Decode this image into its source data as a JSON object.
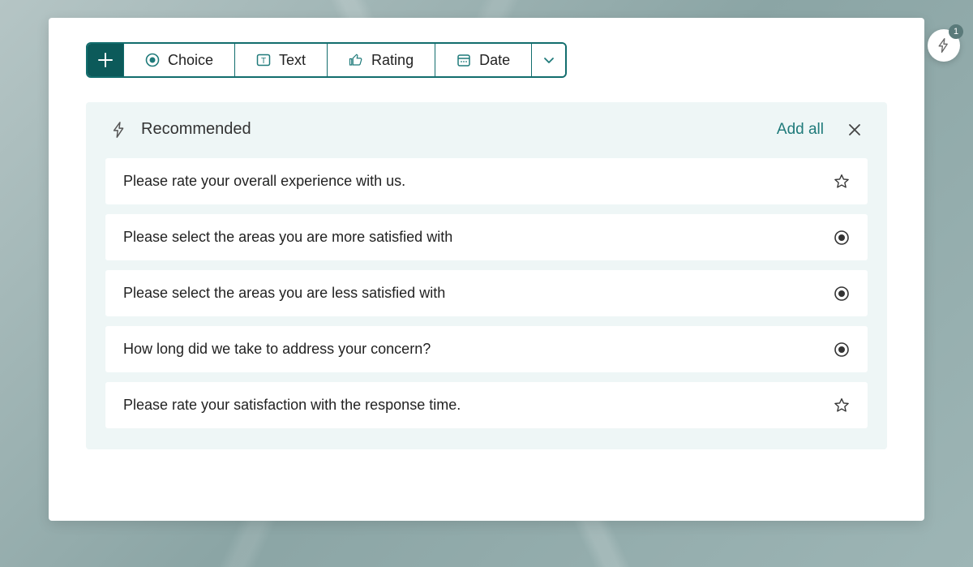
{
  "toolbar": {
    "choice_label": "Choice",
    "text_label": "Text",
    "rating_label": "Rating",
    "date_label": "Date"
  },
  "recommended": {
    "title": "Recommended",
    "add_all_label": "Add all",
    "items": [
      {
        "text": "Please rate your overall experience with us.",
        "type": "rating"
      },
      {
        "text": "Please select the areas you are more satisfied with",
        "type": "choice"
      },
      {
        "text": "Please select the areas you are less satisfied with",
        "type": "choice"
      },
      {
        "text": "How long did we take to address your concern?",
        "type": "choice"
      },
      {
        "text": "Please rate your satisfaction with the response time.",
        "type": "rating"
      }
    ]
  },
  "badge": {
    "count": "1"
  },
  "colors": {
    "teal": "#126d6d",
    "teal_dark": "#0c5a5a",
    "panel_bg": "#eef6f6"
  }
}
